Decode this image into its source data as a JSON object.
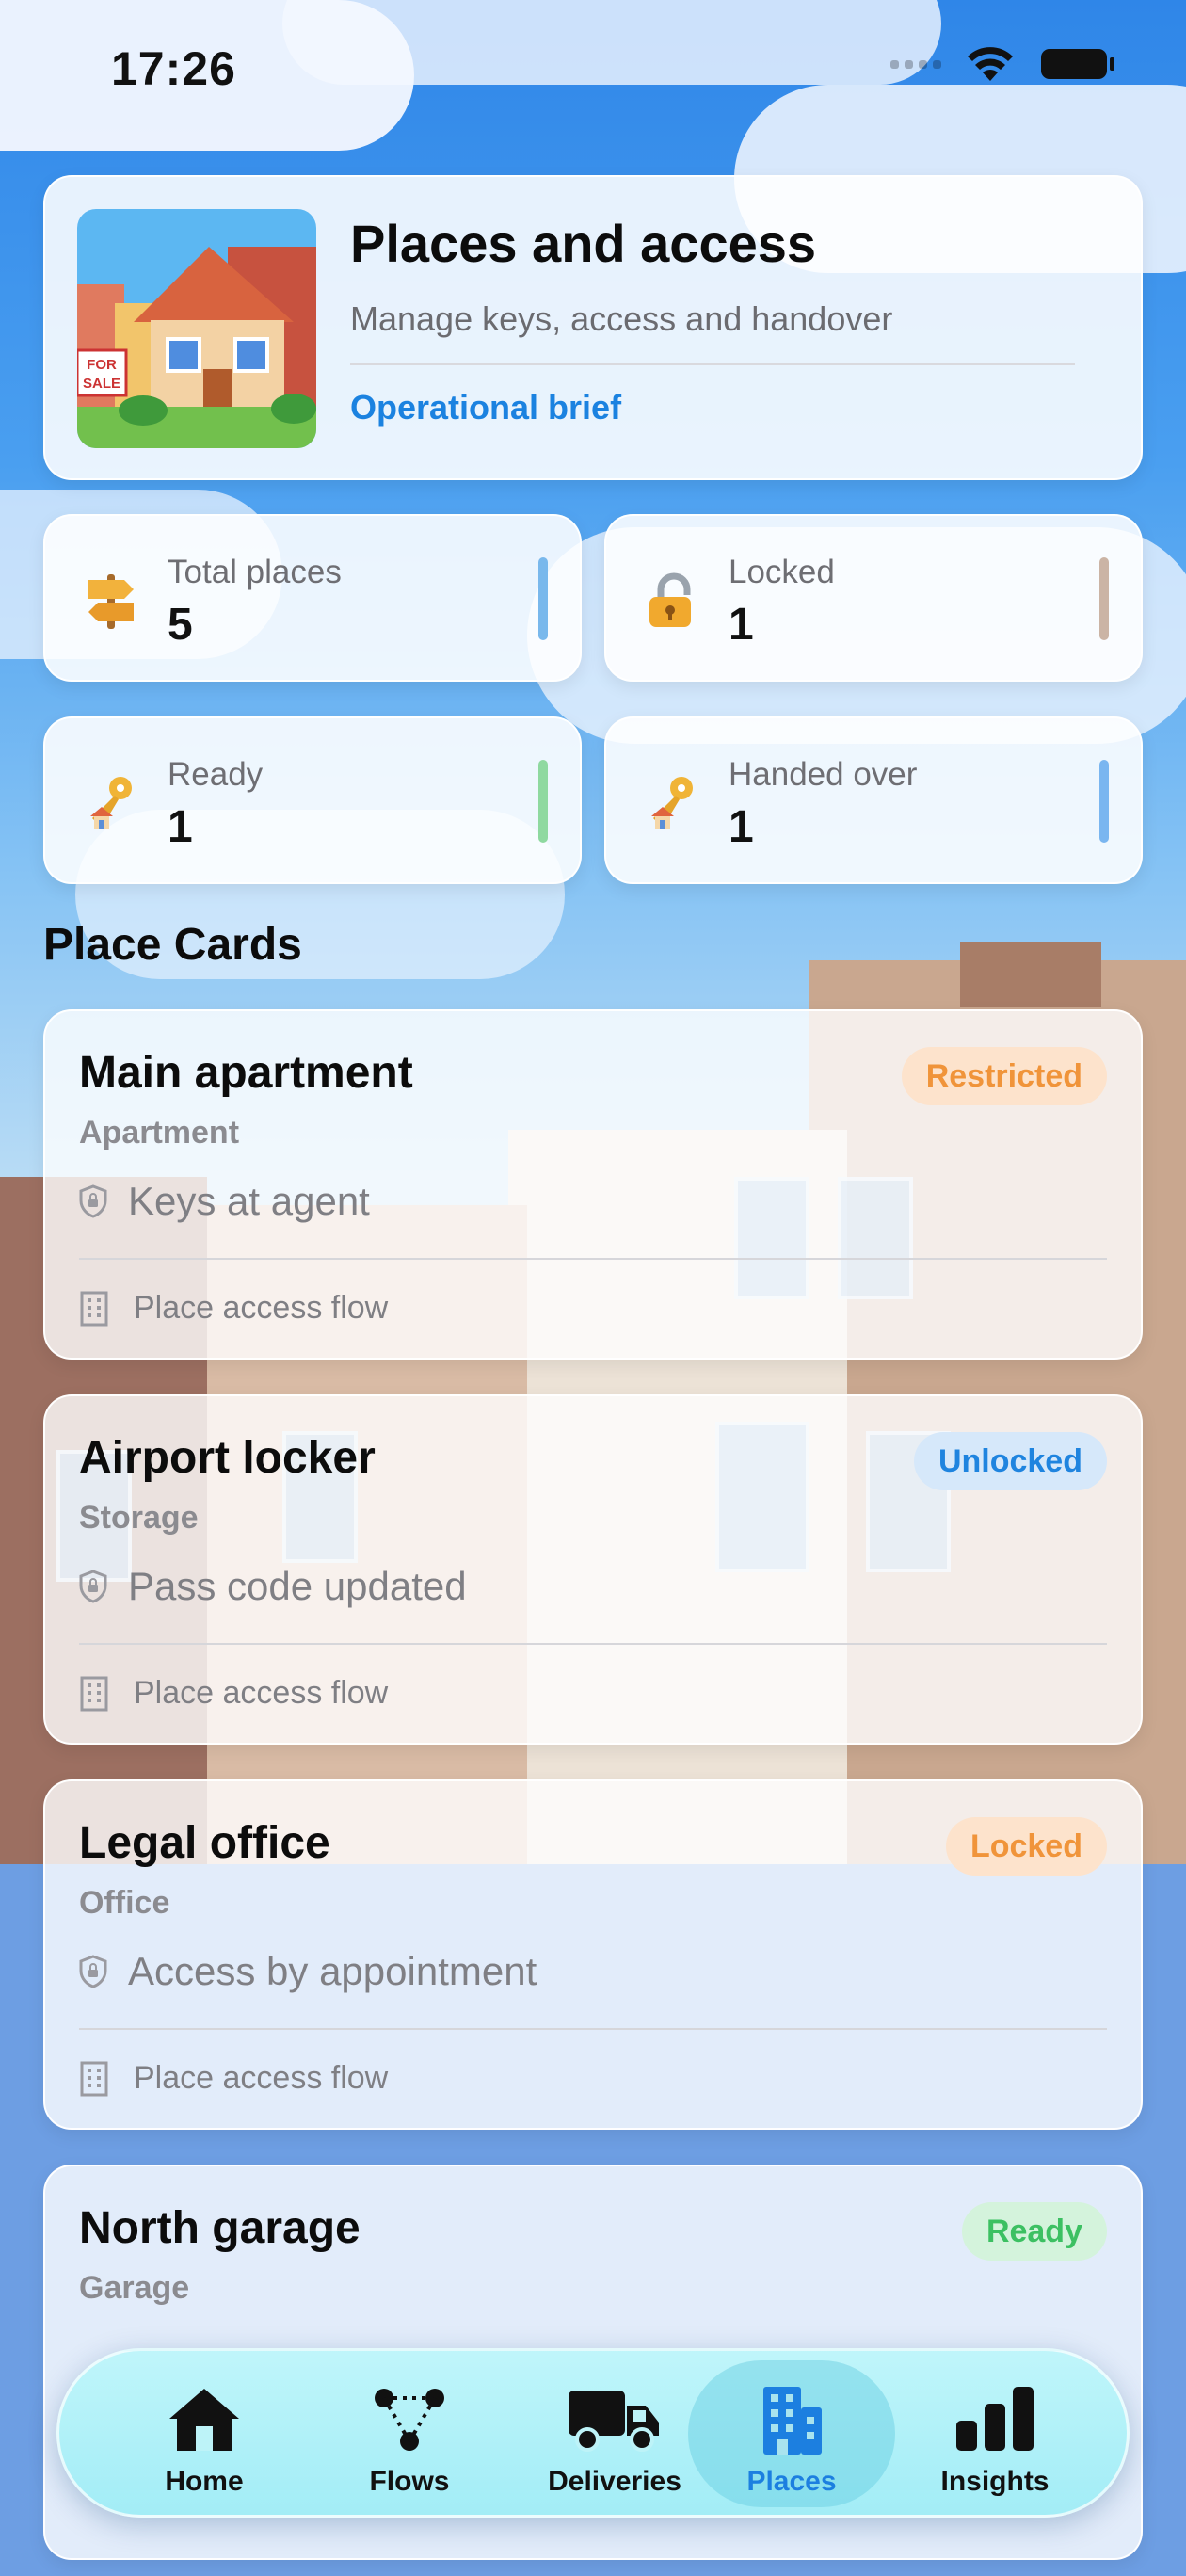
{
  "status_bar": {
    "time": "17:26"
  },
  "header": {
    "title": "Places and access",
    "subtitle": "Manage keys, access and handover",
    "link": "Operational brief",
    "thumb_sign": "FOR SALE"
  },
  "stats": [
    {
      "label": "Total places",
      "value": "5",
      "icon": "signpost-icon",
      "bar_color": "#79b8ec"
    },
    {
      "label": "Locked",
      "value": "1",
      "icon": "padlock-icon",
      "bar_color": "#cbb4a5"
    },
    {
      "label": "Ready",
      "value": "1",
      "icon": "key-house-icon",
      "bar_color": "#8fd9a0"
    },
    {
      "label": "Handed over",
      "value": "1",
      "icon": "key-house-icon",
      "bar_color": "#7ab6f0"
    }
  ],
  "section_title": "Place Cards",
  "places": [
    {
      "name": "Main apartment",
      "type": "Apartment",
      "badge": "Restricted",
      "badge_color": "#f0943a",
      "badge_bg": "#fde3cc",
      "note": "Keys at agent",
      "flow": "Place access flow"
    },
    {
      "name": "Airport locker",
      "type": "Storage",
      "badge": "Unlocked",
      "badge_color": "#1f84df",
      "badge_bg": "#d6e8fa",
      "note": "Pass code updated",
      "flow": "Place access flow"
    },
    {
      "name": "Legal office",
      "type": "Office",
      "badge": "Locked",
      "badge_color": "#f0943a",
      "badge_bg": "#fde3cc",
      "note": "Access by appointment",
      "flow": "Place access flow"
    },
    {
      "name": "North garage",
      "type": "Garage",
      "badge": "Ready",
      "badge_color": "#3cc062",
      "badge_bg": "#d4f3dc",
      "note": "",
      "flow": ""
    }
  ],
  "tabs": [
    {
      "label": "Home",
      "icon": "home-icon",
      "active": false
    },
    {
      "label": "Flows",
      "icon": "flows-icon",
      "active": false
    },
    {
      "label": "Deliveries",
      "icon": "truck-icon",
      "active": false
    },
    {
      "label": "Places",
      "icon": "building-icon",
      "active": true
    },
    {
      "label": "Insights",
      "icon": "chart-icon",
      "active": false
    }
  ],
  "colors": {
    "accent": "#1b82e0",
    "text": "#0c0c0c",
    "muted": "#6e6e73"
  }
}
